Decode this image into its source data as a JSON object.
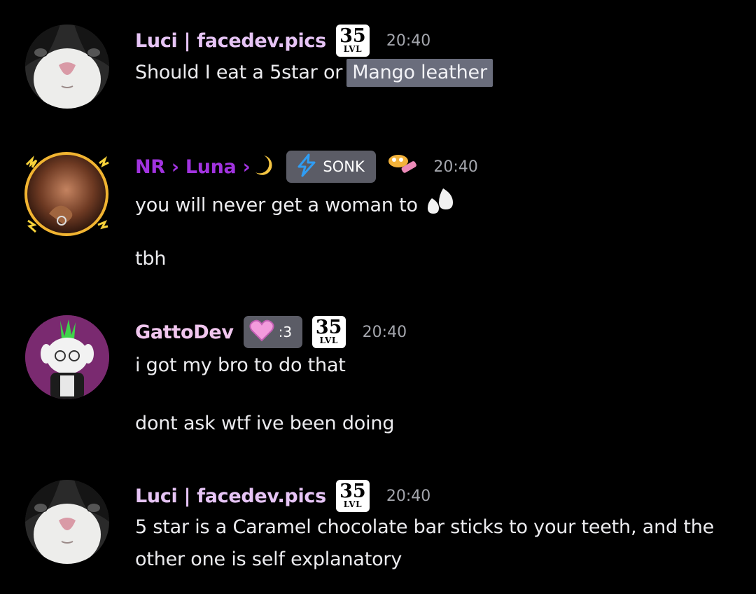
{
  "messages": [
    {
      "author": "Luci | facedev.pics",
      "author_color": "#e6c4f5",
      "level_badge": {
        "number": "35",
        "label": "LVL"
      },
      "time": "20:40",
      "text": "Should I eat a 5star or",
      "mention": "Mango leather"
    },
    {
      "author": "NR › Luna ›",
      "author_color": "#a233e0",
      "role_tag": {
        "icon": "lightning-icon",
        "label": "SONK"
      },
      "time": "20:40",
      "line1": "you will never get a woman to",
      "line2": "tbh"
    },
    {
      "author": "GattoDev",
      "author_color": "#f0c6ee",
      "role_tag": {
        "icon": "heart-icon",
        "label": ":3"
      },
      "level_badge": {
        "number": "35",
        "label": "LVL"
      },
      "time": "20:40",
      "line1": "i got my bro to do that",
      "line2": "dont ask wtf ive been doing"
    },
    {
      "author": "Luci | facedev.pics",
      "author_color": "#e6c4f5",
      "level_badge": {
        "number": "35",
        "label": "LVL"
      },
      "time": "20:40",
      "line1": "5 star is a Caramel chocolate bar sticks to your teeth, and the",
      "line2": "other one is self explanatory"
    }
  ]
}
